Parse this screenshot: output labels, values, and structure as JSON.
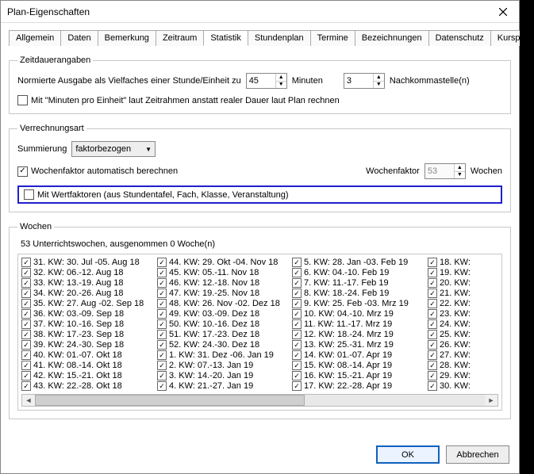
{
  "window": {
    "title": "Plan-Eigenschaften"
  },
  "tabs": [
    "Allgemein",
    "Daten",
    "Bemerkung",
    "Zeitraum",
    "Statistik",
    "Stundenplan",
    "Termine",
    "Bezeichnungen",
    "Datenschutz",
    "Kursplan"
  ],
  "active_tab": "Statistik",
  "zeitdauer": {
    "legend": "Zeitdauerangaben",
    "label_pre": "Normierte Ausgabe als Vielfaches einer Stunde/Einheit zu",
    "minutes": "45",
    "label_minutes": "Minuten",
    "decimals": "3",
    "label_decimals": "Nachkommastelle(n)",
    "cb_minprounit": "Mit \"Minuten pro Einheit\" laut Zeitrahmen anstatt realer Dauer laut Plan rechnen"
  },
  "verrechnung": {
    "legend": "Verrechnungsart",
    "label_summierung": "Summierung",
    "combo_value": "faktorbezogen",
    "cb_wochenfaktor_auto": "Wochenfaktor automatisch berechnen",
    "label_wochenfaktor": "Wochenfaktor",
    "wochenfaktor_value": "53",
    "label_wochen": "Wochen",
    "cb_wertfaktoren": "Mit Wertfaktoren (aus Stundentafel, Fach, Klasse, Veranstaltung)"
  },
  "wochen": {
    "legend": "Wochen",
    "summary": "53 Unterrichtswochen, ausgenommen 0 Woche(n)",
    "col1": [
      "31. KW: 30. Jul -05. Aug 18",
      "32. KW: 06.-12. Aug 18",
      "33. KW: 13.-19. Aug 18",
      "34. KW: 20.-26. Aug 18",
      "35. KW: 27. Aug -02. Sep 18",
      "36. KW: 03.-09. Sep 18",
      "37. KW: 10.-16. Sep 18",
      "38. KW: 17.-23. Sep 18",
      "39. KW: 24.-30. Sep 18",
      "40. KW: 01.-07. Okt 18",
      "41. KW: 08.-14. Okt 18",
      "42. KW: 15.-21. Okt 18",
      "43. KW: 22.-28. Okt 18"
    ],
    "col2": [
      "44. KW: 29. Okt -04. Nov 18",
      "45. KW: 05.-11. Nov 18",
      "46. KW: 12.-18. Nov 18",
      "47. KW: 19.-25. Nov 18",
      "48. KW: 26. Nov -02. Dez 18",
      "49. KW: 03.-09. Dez 18",
      "50. KW: 10.-16. Dez 18",
      "51. KW: 17.-23. Dez 18",
      "52. KW: 24.-30. Dez 18",
      "1. KW: 31. Dez -06. Jan 19",
      "2. KW: 07.-13. Jan 19",
      "3. KW: 14.-20. Jan 19",
      "4. KW: 21.-27. Jan 19"
    ],
    "col3": [
      "5. KW: 28. Jan -03. Feb 19",
      "6. KW: 04.-10. Feb 19",
      "7. KW: 11.-17. Feb 19",
      "8. KW: 18.-24. Feb 19",
      "9. KW: 25. Feb -03. Mrz 19",
      "10. KW: 04.-10. Mrz 19",
      "11. KW: 11.-17. Mrz 19",
      "12. KW: 18.-24. Mrz 19",
      "13. KW: 25.-31. Mrz 19",
      "14. KW: 01.-07. Apr 19",
      "15. KW: 08.-14. Apr 19",
      "16. KW: 15.-21. Apr 19",
      "17. KW: 22.-28. Apr 19"
    ],
    "col4": [
      "18. KW:",
      "19. KW:",
      "20. KW:",
      "21. KW:",
      "22. KW:",
      "23. KW:",
      "24. KW:",
      "25. KW:",
      "26. KW:",
      "27. KW:",
      "28. KW:",
      "29. KW:",
      "30. KW:"
    ]
  },
  "buttons": {
    "ok": "OK",
    "cancel": "Abbrechen"
  }
}
